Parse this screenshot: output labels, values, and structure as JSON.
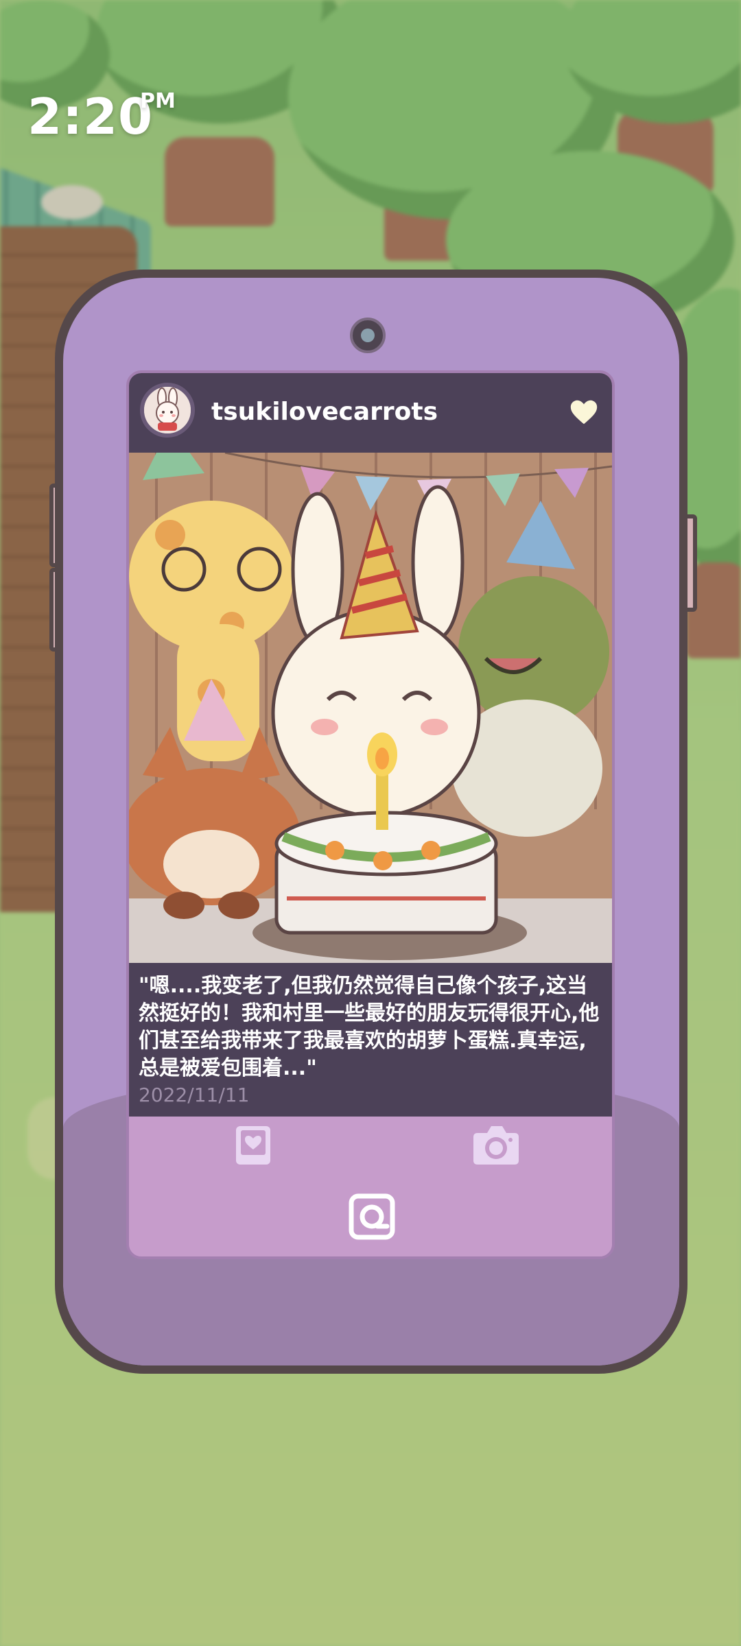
{
  "clock": {
    "time": "2:20",
    "ampm": "PM"
  },
  "post": {
    "username": "tsukilovecarrots",
    "caption": "\"嗯....我变老了,但我仍然觉得自己像个孩子,这当然挺好的！我和村里一些最好的朋友玩得很开心,他们甚至给我带来了我最喜欢的胡萝卜蛋糕.真幸运,总是被爱包围着...\"",
    "date": "2022/11/11"
  },
  "icons": {
    "heart": "heart-icon",
    "album": "photo-album-icon",
    "camera": "camera-icon",
    "app": "feed-app-icon"
  },
  "colors": {
    "phone_body": "#b094c9",
    "screen_header": "#4c4158",
    "screen_bg": "#c69ccb",
    "accent_icon": "#e9d7f2"
  }
}
